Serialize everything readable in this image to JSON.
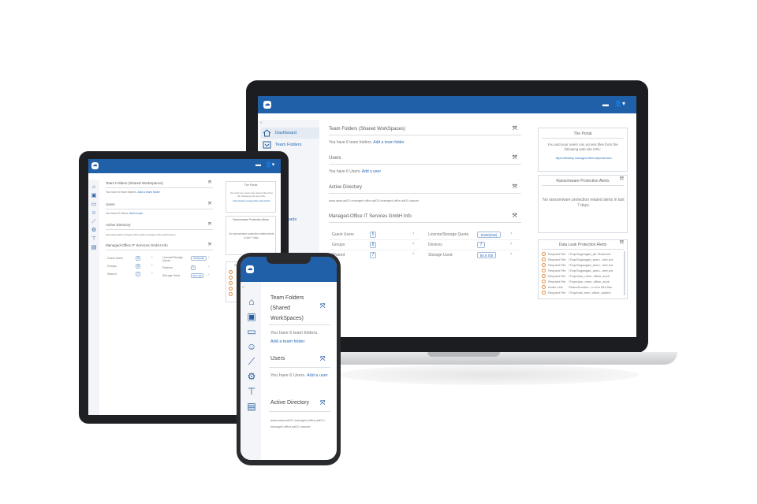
{
  "header": {
    "logo_icon": "cloud-icon",
    "folder_icon": "folder-icon",
    "user_icon": "user-icon"
  },
  "laptop": {
    "sidebar": [
      {
        "label": "Dashboard",
        "icon": "home-icon"
      },
      {
        "label": "Team Folders",
        "icon": "shared-folder-icon"
      },
      {
        "label": "",
        "icon": ""
      },
      {
        "label": "Downloads",
        "icon": "download-icon"
      }
    ],
    "team_folders": {
      "title": "Team Folders (Shared WorkSpaces)",
      "text": "You have 6 team folders.",
      "link": "Add a team folder"
    },
    "users": {
      "title": "Users",
      "text": "You have 6 Users.",
      "link": "Add a user"
    },
    "active_directory": {
      "title": "Active Directory",
      "text": "aaaa.aaaa,aaDC=managed-office,aaDC=managed-office,aaDC=aauser"
    },
    "info": {
      "title": "Managed-Office IT Services GmbH Info",
      "left": [
        {
          "label": "Guest Users",
          "value": "5"
        },
        {
          "label": "Groups",
          "value": "8"
        },
        {
          "label": "Shared",
          "value": "7"
        }
      ],
      "right": [
        {
          "label": "License/Storage Quota",
          "value": "6/200(GB)"
        },
        {
          "label": "Devices",
          "value": "7"
        },
        {
          "label": "Storage Used",
          "value": "55.6 GB"
        }
      ]
    },
    "portal": {
      "title": "The Portal",
      "text": "You and your users can access files from the following web site URL:",
      "url": "https://desktop.managed-office.at/portal.html"
    },
    "ransomware": {
      "title": "Ransomware Protection Alerts",
      "text": "No ransomware protection related alerts in last 7 days."
    },
    "dlp": {
      "title": "Data Leak Protection Alerts",
      "rows": [
        [
          "Request File",
          "/Tmp/Sugangad_ab..Rulserod"
        ],
        [
          "Request File",
          "/Tmp/Sugangad_aneu...met.rcd"
        ],
        [
          "Request File",
          "/Tmp/Sugangad_aneu...met.rcd"
        ],
        [
          "Request File",
          "/Tmp/Sugangad_aneu...met.rcd"
        ],
        [
          "Request File",
          "/Tmp/obar_mem..office_auch"
        ],
        [
          "Request File",
          "/Tmp/obar_mem..office_auch"
        ],
        [
          "Audio Link",
          "Share/Kundeh...n.com 554.6ac"
        ],
        [
          "Request File",
          "/Tmp/mail_men..office_aubem"
        ]
      ]
    }
  },
  "tablet": {
    "team_folders": {
      "title": "Team Folders (Shared WorkSpaces)",
      "text": "You have 6 team folders.",
      "link": "Add a team folder"
    },
    "users": {
      "title": "Users",
      "text": "You have 6 Users.",
      "link": "Add a user"
    },
    "active_directory": {
      "title": "Active Directory",
      "text": "aaaa.aaaa,aaDC=managed-office,aaDC=managed-office,aaDC=aauser"
    },
    "info": {
      "title": "Managed-Office IT Services GmbH Info",
      "left": [
        {
          "label": "Guest Users",
          "value": "5"
        },
        {
          "label": "Groups",
          "value": "8"
        },
        {
          "label": "Shared",
          "value": "7"
        }
      ],
      "right": [
        {
          "label": "License/Storage Quota",
          "value": "6/200(GB)"
        },
        {
          "label": "Devices",
          "value": "7"
        },
        {
          "label": "Storage Used",
          "value": "55.6 GB"
        }
      ]
    },
    "portal": {
      "title": "The Portal",
      "text": "You and your users can access files from the following web site URL:",
      "url": "https://desktop.managed-office.at/portal.html"
    },
    "ransomware": {
      "title": "Ransomware Protection Alerts",
      "text": "No ransomware protection related alerts in last 7 days."
    },
    "dlp": {
      "title": "Data Leak Protection Alerts"
    }
  },
  "phone": {
    "team_folders": {
      "title": "Team Folders (Shared WorkSpaces)",
      "text": "You have 6 team folders.",
      "link": "Add a team folder"
    },
    "users": {
      "title": "Users",
      "text": "You have 6 Users.",
      "link": "Add a user"
    },
    "active_directory": {
      "title": "Active Directory",
      "text": "aaaa.aaaa,aaDC=managed-office,aaDC=managed-office,aaDC=aauser"
    }
  },
  "colors": {
    "brand": "#2060a8",
    "link": "#2a6db5",
    "alert": "#e28a3c"
  }
}
